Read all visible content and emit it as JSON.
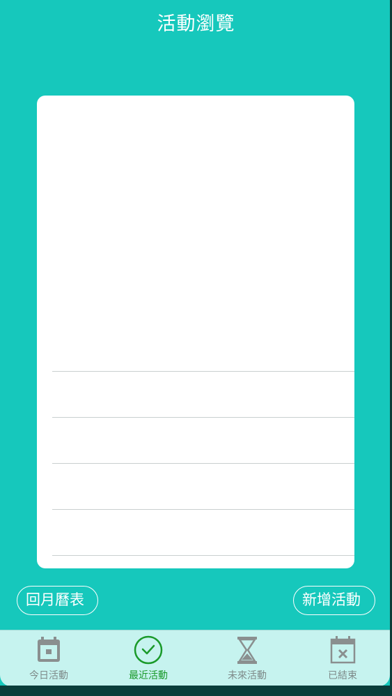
{
  "header": {
    "title": "活動瀏覽"
  },
  "card": {
    "rows": 5
  },
  "actions": {
    "back_to_calendar_label": "回月曆表",
    "add_event_label": "新增活動"
  },
  "tabs": [
    {
      "label": "今日活動",
      "icon": "calendar-icon",
      "active": false
    },
    {
      "label": "最近活動",
      "icon": "check-circle-icon",
      "active": true
    },
    {
      "label": "未來活動",
      "icon": "hourglass-icon",
      "active": false
    },
    {
      "label": "已結束",
      "icon": "calendar-x-icon",
      "active": false
    }
  ],
  "colors": {
    "background": "#16c8bc",
    "card": "#ffffff",
    "tabbar": "#c6f3ef",
    "active_tab": "#1a9a2a",
    "inactive_tab": "#7e8a89"
  }
}
